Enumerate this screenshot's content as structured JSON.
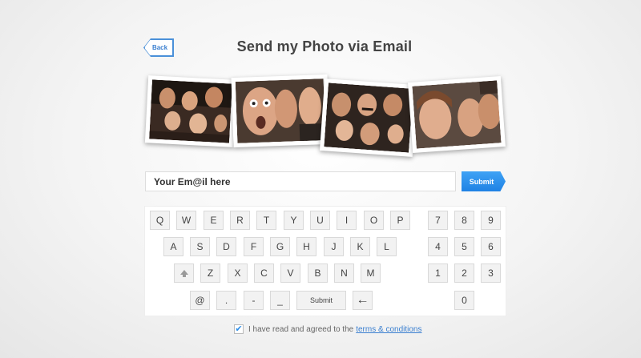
{
  "header": {
    "back_label": "Back",
    "title": "Send my Photo via Email"
  },
  "photos": [
    {
      "name": "photo-strip-1"
    },
    {
      "name": "photo-strip-2"
    },
    {
      "name": "photo-strip-3"
    },
    {
      "name": "photo-strip-4"
    }
  ],
  "email": {
    "value": "Your Em@il here",
    "submit_label": "Submit"
  },
  "keyboard": {
    "row1": [
      "Q",
      "W",
      "E",
      "R",
      "T",
      "Y",
      "U",
      "I",
      "O",
      "P"
    ],
    "row2": [
      "A",
      "S",
      "D",
      "F",
      "G",
      "H",
      "J",
      "K",
      "L"
    ],
    "row3": [
      "Z",
      "X",
      "C",
      "V",
      "B",
      "N",
      "M"
    ],
    "row4": [
      "@",
      ".",
      "-",
      "_"
    ],
    "submit_label": "Submit",
    "backspace_glyph": "←",
    "numpad": [
      "7",
      "8",
      "9",
      "4",
      "5",
      "6",
      "1",
      "2",
      "3",
      "0"
    ]
  },
  "terms": {
    "checked_glyph": "✔",
    "text": "I have read and agreed to the",
    "link": "terms & conditions"
  },
  "colors": {
    "accent": "#2b8de8",
    "link": "#3a7fd0"
  }
}
